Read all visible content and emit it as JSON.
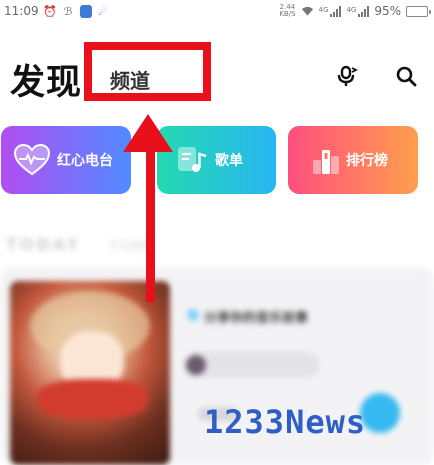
{
  "status_bar": {
    "time": "11:09",
    "net_speed_value": "2.44",
    "net_speed_unit": "KB/S",
    "network_tag_1": "4G",
    "network_tag_2": "4G",
    "battery_text": "95%",
    "battery_level": 0.95,
    "battery_color": "#4cc36e"
  },
  "header": {
    "title": "发现",
    "channel_tab": "频道",
    "icons": [
      "mic-icon",
      "search-icon"
    ]
  },
  "categories": [
    {
      "label": "红心电台",
      "icon": "heart-radio-icon",
      "gradient": [
        "#b24ef0",
        "#4f8bff"
      ]
    },
    {
      "label": "歌单",
      "icon": "playlist-icon",
      "gradient": [
        "#25d9b0",
        "#27b6f2"
      ]
    },
    {
      "label": "排行榜",
      "icon": "ranking-icon",
      "gradient": [
        "#ff4e7e",
        "#ff9f4d"
      ]
    }
  ],
  "feed": {
    "section_title": "TODAY",
    "section_subtitle": "今日推荐",
    "item_title": "分享你的音乐故事"
  },
  "annotation": {
    "highlight_color": "#e8111b"
  },
  "watermark": "1233News"
}
